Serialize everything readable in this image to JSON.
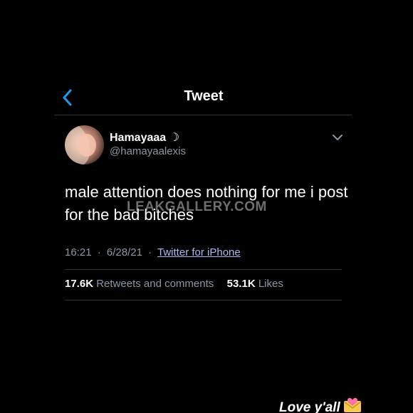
{
  "header": {
    "back_icon": "chevron-left-icon",
    "title": "Tweet"
  },
  "tweet": {
    "author": {
      "display_name": "Hamayaaa ☽",
      "handle": "@hamayaalexis",
      "avatar_icon": "avatar-photo"
    },
    "more_icon": "chevron-down-icon",
    "text": "male attention does nothing for me i post for the bad bitches",
    "time": "16:21",
    "date": "6/28/21",
    "separator": "·",
    "source": "Twitter for iPhone",
    "stats": {
      "retweets_count": "17.6K",
      "retweets_label": "Retweets and comments",
      "likes_count": "53.1K",
      "likes_label": "Likes"
    }
  },
  "overlay": {
    "watermark": "LEAKGALLERY.COM",
    "caption": "Love y'all",
    "caption_emoji": "heart-envelope-emoji"
  },
  "colors": {
    "background": "#000000",
    "text_primary": "#ffffff",
    "text_secondary": "#8b98a5",
    "link": "#a9b8f5",
    "divider": "#2f3336",
    "accent": "#1d9bf0"
  }
}
